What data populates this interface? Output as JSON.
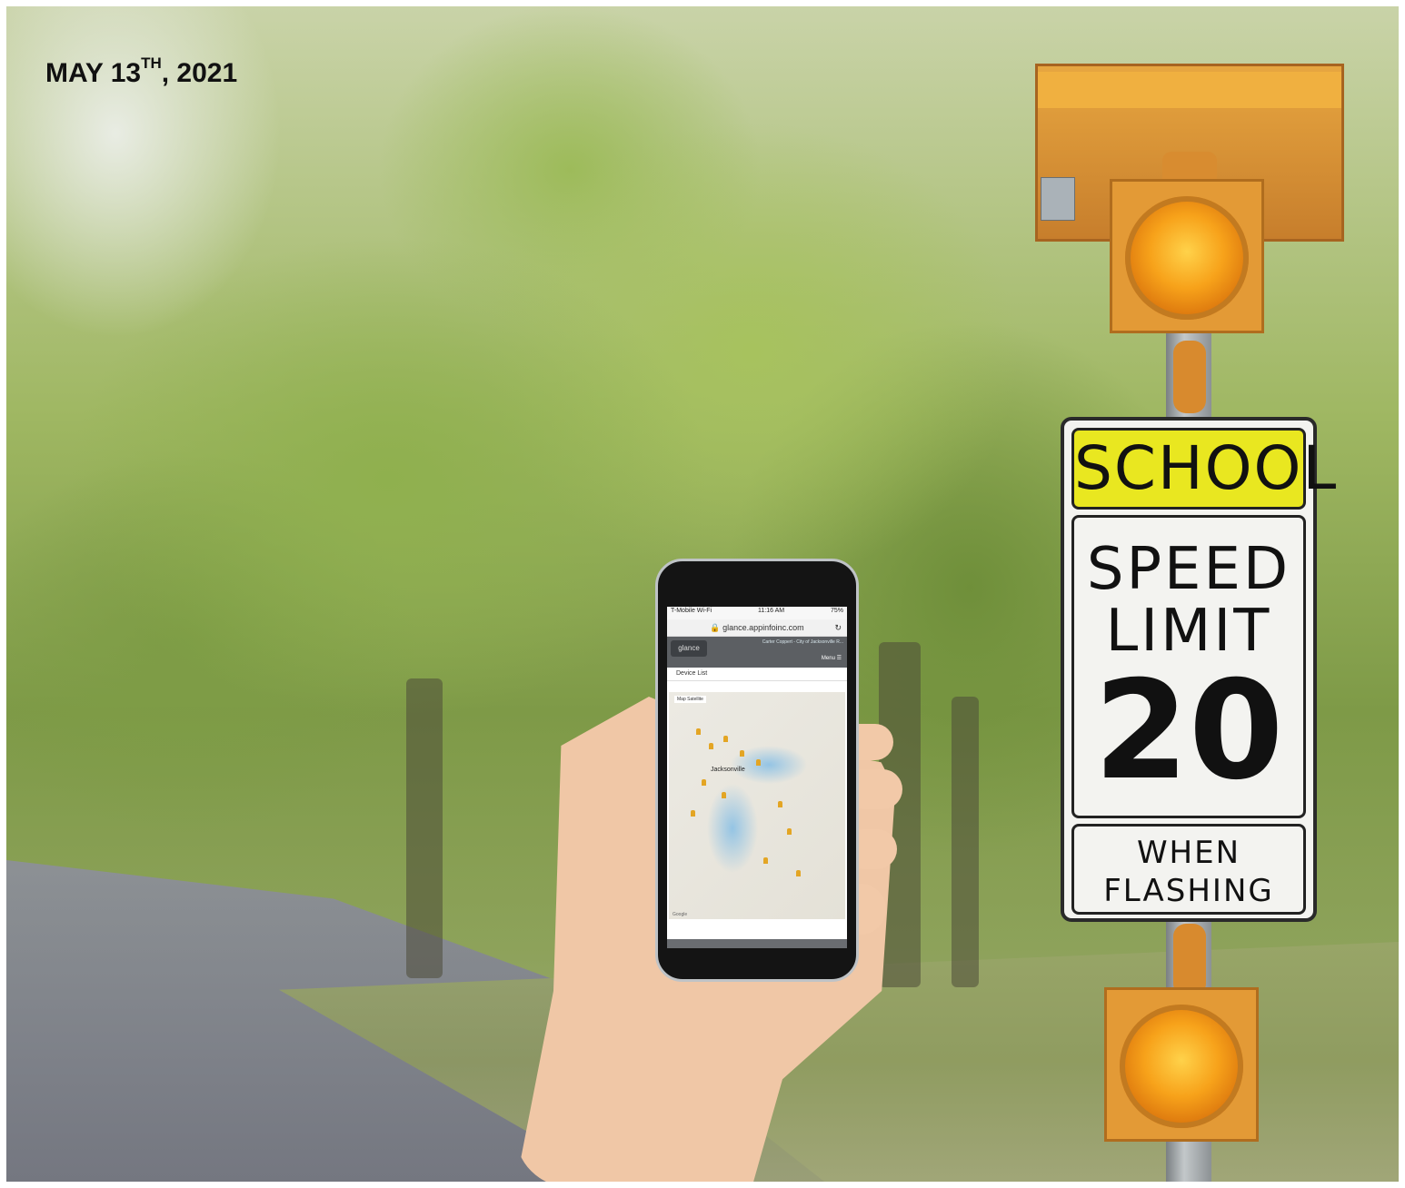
{
  "date_prefix": "MAY 13",
  "date_suffix": "TH",
  "date_year": ", 2021",
  "sign": {
    "school": "SCHOOL",
    "speed": "SPEED",
    "limit": "LIMIT",
    "number": "20",
    "when": "WHEN",
    "flashing": "FLASHING"
  },
  "phone": {
    "carrier": "T-Mobile Wi-Fi",
    "time": "11:16 AM",
    "battery": "75%",
    "url": "glance.appinfoinc.com",
    "app_logo": "glance",
    "app_info": "Carter Coppert - City of Jacksonville R...",
    "menu_label": "Menu",
    "device_list_label": "Device List",
    "map_tab": "Map",
    "satellite_tab": "Satellite",
    "city_label": "Jacksonville",
    "map_footer": "Google"
  },
  "colors": {
    "sign_yellow": "#e9e720",
    "beacon_amber": "#f7a21a",
    "foliage_green": "#8fb04e"
  }
}
